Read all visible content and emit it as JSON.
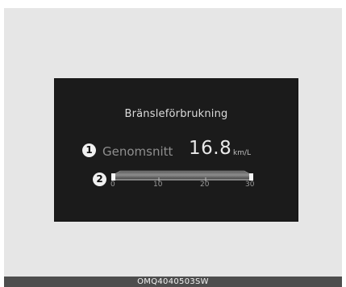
{
  "display": {
    "title": "Bränsleförbrukning",
    "average_label": "Genomsnitt",
    "average_value": "16.8",
    "average_unit": "km/L",
    "markers": [
      "1",
      "2"
    ],
    "scale": {
      "ticks": [
        "0",
        "10",
        "20",
        "30"
      ],
      "min": 0,
      "max": 30,
      "current_value": 16.8
    }
  },
  "caption": "OMQ4040503SW"
}
